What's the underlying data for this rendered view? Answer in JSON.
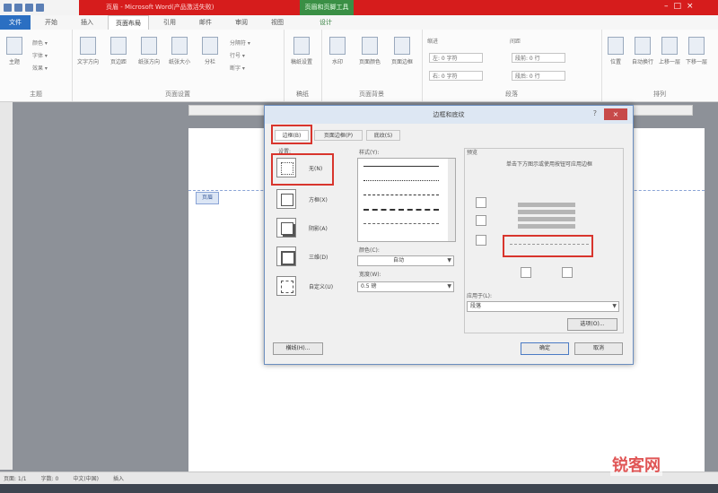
{
  "window": {
    "title": "页眉 - Microsoft Word(产品激活失败)",
    "context_tab_title": "页眉和页脚工具",
    "controls": [
      "–",
      "□",
      "×"
    ]
  },
  "ribbon_tabs": [
    "文件",
    "开始",
    "插入",
    "页面布局",
    "引用",
    "邮件",
    "审阅",
    "视图",
    "设计"
  ],
  "ribbon": {
    "groups": [
      {
        "label": "主题",
        "buttons": [
          "主题"
        ],
        "small": [
          "颜色 ▾",
          "字体 ▾",
          "效果 ▾"
        ]
      },
      {
        "label": "页面设置",
        "buttons": [
          "文字方向",
          "页边距",
          "纸张方向",
          "纸张大小",
          "分栏"
        ],
        "small": [
          "分隔符 ▾",
          "行号 ▾",
          "断字 ▾"
        ]
      },
      {
        "label": "稿纸",
        "buttons": [
          "稿纸设置"
        ]
      },
      {
        "label": "页面背景",
        "buttons": [
          "水印",
          "页面颜色",
          "页面边框"
        ]
      },
      {
        "label": "段落",
        "indent_label": "缩进",
        "spacing_label": "间距",
        "indent_left": "左: 0 字符",
        "indent_right": "右: 0 字符",
        "space_before": "段前: 0 行",
        "space_after": "段后: 0 行"
      },
      {
        "label": "排列",
        "buttons": [
          "位置",
          "自动换行",
          "上移一层",
          "下移一层"
        ]
      }
    ]
  },
  "document": {
    "header_tag": "页眉"
  },
  "dialog": {
    "title": "边框和底纹",
    "help": "?",
    "close": "×",
    "tabs": [
      "边框(B)",
      "页面边框(P)",
      "底纹(S)"
    ],
    "settings_label": "设置:",
    "settings": [
      "无(N)",
      "方框(X)",
      "阴影(A)",
      "三维(D)",
      "自定义(U)"
    ],
    "style_label": "样式(Y):",
    "color_label": "颜色(C):",
    "color_value": "自动",
    "width_label": "宽度(W):",
    "width_value": "0.5 磅",
    "preview_label": "预览",
    "preview_hint": "单击下方图示或使用按钮可应用边框",
    "apply_label": "应用于(L):",
    "apply_value": "段落",
    "options_button": "选项(O)...",
    "hline_button": "横线(H)...",
    "ok_button": "确定",
    "cancel_button": "取消"
  },
  "status_bar": {
    "page": "页面: 1/1",
    "words": "字数: 0",
    "language": "中文(中国)",
    "mode": "插入"
  },
  "watermark": "锐客网"
}
